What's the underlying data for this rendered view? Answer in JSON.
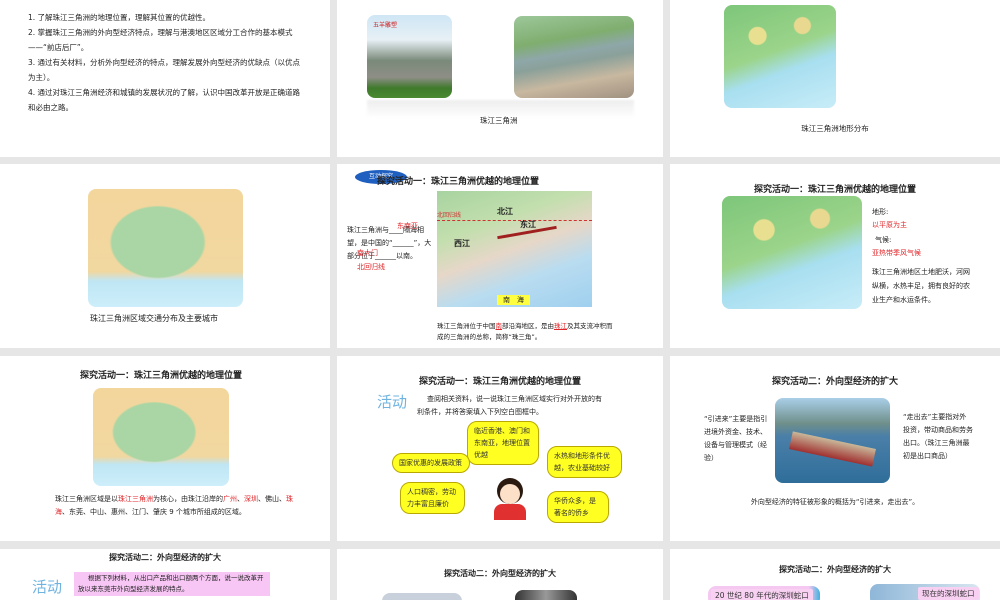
{
  "slides": [
    {
      "objectives": [
        "1. 了解珠江三角洲的地理位置，理解其位置的优越性。",
        "2. 掌握珠江三角洲的外向型经济特点，理解与港澳地区区域分工合作的基本模式——“前店后厂”。",
        "3. 通过有关材料，分析外向型经济的特点，理解发展外向型经济的优缺点（以优点为主）。",
        "4. 通过对珠江三角洲经济和城镇的发展状况的了解，认识中国改革开放是正确道路和必由之路。"
      ]
    },
    {
      "image_label": "五羊雕塑",
      "caption": "珠江三角洲"
    },
    {
      "caption": "珠江三角洲地形分布"
    },
    {
      "caption": "珠江三角洲区域交通分布及主要城市"
    },
    {
      "badge": "互动探究",
      "title": "探究活动一：珠江三角洲优越的地理位置",
      "left_parts": [
        "珠江三角洲与",
        "____隔海相望，是中国的“______”，大部分位于______以南。"
      ],
      "answers": [
        "东南亚",
        "南大门",
        "北回归线"
      ],
      "map_labels": {
        "tropic": "北回归线",
        "beijiang": "北江",
        "dongjiang": "东江",
        "xijiang": "西江",
        "sea": "南　海"
      },
      "bottom_parts": [
        "珠江三角洲位于中国",
        "部沿海地区，是由",
        "及其支流冲积而成的三角洲的总称，简称“珠三角”。"
      ],
      "bottom_answers": [
        "南",
        "珠江"
      ]
    },
    {
      "title": "探究活动一：珠江三角洲优越的地理位置",
      "terrain_label": "地形:",
      "terrain": "以平原为主",
      "climate_label": "气候:",
      "climate": "亚热带季风气候",
      "desc": "珠江三角洲地区土地肥沃，河网纵横，水热丰足，拥有良好的农业生产和水运条件。"
    },
    {
      "title": "探究活动一：珠江三角洲优越的地理位置",
      "parts": [
        "珠江三角洲区域是以",
        "珠江三角洲",
        "为核心，由珠江沿岸的",
        "广州",
        "、",
        "深圳",
        "、佛山、",
        "珠海",
        "、东莞、中山、惠州、江门、肇庆 9 个城市所组成的区域。"
      ]
    },
    {
      "title": "探究活动一：珠江三角洲优越的地理位置",
      "activity": "活动",
      "prompt": "查阅相关资料，说一说珠江三角洲区域实行对外开放的有利条件，并将答案填入下列空白图框中。",
      "bubbles": [
        "临近香港、澳门和东南亚，地理位置优越",
        "国家优惠的发展政策",
        "水热和地形条件优越，农业基础较好",
        "人口稠密，劳动力丰富且廉价",
        "华侨众多，是著名的侨乡"
      ]
    },
    {
      "title": "探究活动二：外向型经济的扩大",
      "left": "“引进来”主要是指引进境外资金、技术、设备与管理模式（经验）",
      "right": "“走出去”主要指对外投资，带动商品和劳务出口。（珠江三角洲最初是出口商品）",
      "bottom": "外向型经济的特征被形象的概括为“引进来，走出去”。"
    },
    {
      "title": "探究活动二：外向型经济的扩大",
      "activity": "活动",
      "prompt": "根据下列材料，从出口产品和出口额两个方面，说一说改革开放以来东莞市外向型经济发展的特点。"
    },
    {
      "title": "探究活动二：外向型经济的扩大"
    },
    {
      "title": "探究活动二：外向型经济的扩大",
      "label_left": "20 世纪 80 年代的深圳蛇口",
      "label_right": "现在的深圳蛇口"
    }
  ],
  "colors": {
    "answer": "#e0262a",
    "bubble": "#ffff22",
    "badge": "#1f5fbf",
    "background": "#e6e6e6"
  }
}
